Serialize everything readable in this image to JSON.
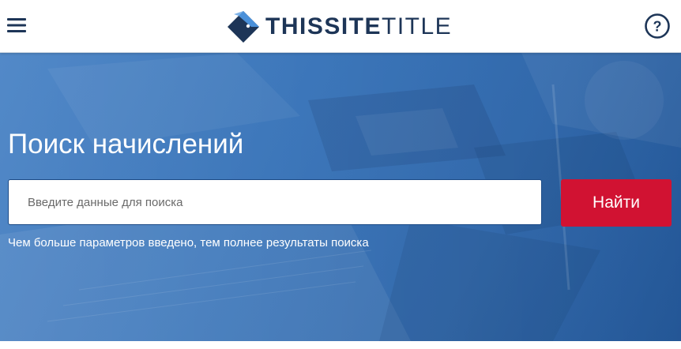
{
  "header": {
    "logo": {
      "text_bold": "THISSITE",
      "text_light": "TITLE"
    },
    "menu_icon": "hamburger-menu-icon",
    "help_icon": "question-circle-icon",
    "help_symbol": "?"
  },
  "hero": {
    "title": "Поиск начислений",
    "search": {
      "placeholder": "Введите данные для поиска",
      "value": ""
    },
    "search_button_label": "Найти",
    "hint": "Чем больше параметров введено, тем полнее результаты поиска"
  },
  "colors": {
    "brand_navy": "#1d3557",
    "hero_blue": "#2f6db5",
    "button_red": "#d11232"
  }
}
